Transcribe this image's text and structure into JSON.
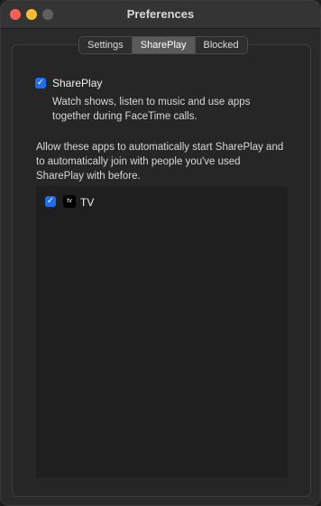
{
  "window": {
    "title": "Preferences"
  },
  "tabs": [
    {
      "label": "Settings"
    },
    {
      "label": "SharePlay"
    },
    {
      "label": "Blocked"
    }
  ],
  "shareplay_option": {
    "label": "SharePlay",
    "checked": true,
    "description_lines": [
      "Watch shows, listen to music and use apps",
      "together during FaceTime calls."
    ]
  },
  "allow_section": {
    "text_lines": [
      "Allow these apps to automatically start SharePlay and",
      "to automatically join with people you've used",
      "SharePlay with before."
    ]
  },
  "apps": [
    {
      "name": "TV",
      "checked": true,
      "icon_text": "tv"
    }
  ],
  "colors": {
    "accent": "#1d6ff2"
  }
}
